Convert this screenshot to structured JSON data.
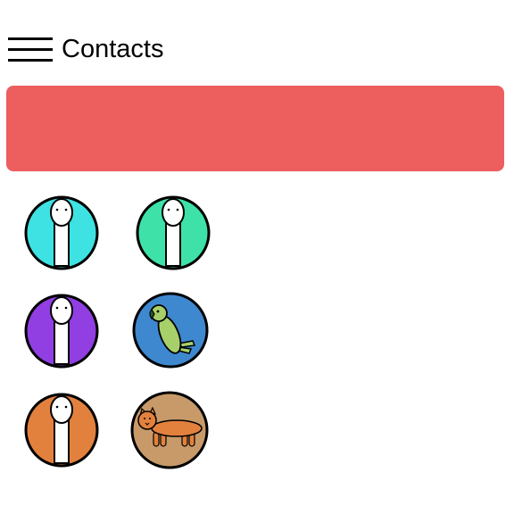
{
  "header": {
    "menu_icon": "hamburger-menu-icon",
    "title": "Contacts"
  },
  "banner": {
    "color": "#ed5e5e"
  },
  "contacts": [
    {
      "avatar": "person",
      "color": "#3ee2e2"
    },
    {
      "avatar": "person",
      "color": "#3ee2a8"
    },
    {
      "avatar": "person",
      "color": "#913ee2"
    },
    {
      "avatar": "parrot",
      "color": "#3e88d0"
    },
    {
      "avatar": "person",
      "color": "#e2813e"
    },
    {
      "avatar": "cat",
      "color": "#c89a6a"
    }
  ]
}
